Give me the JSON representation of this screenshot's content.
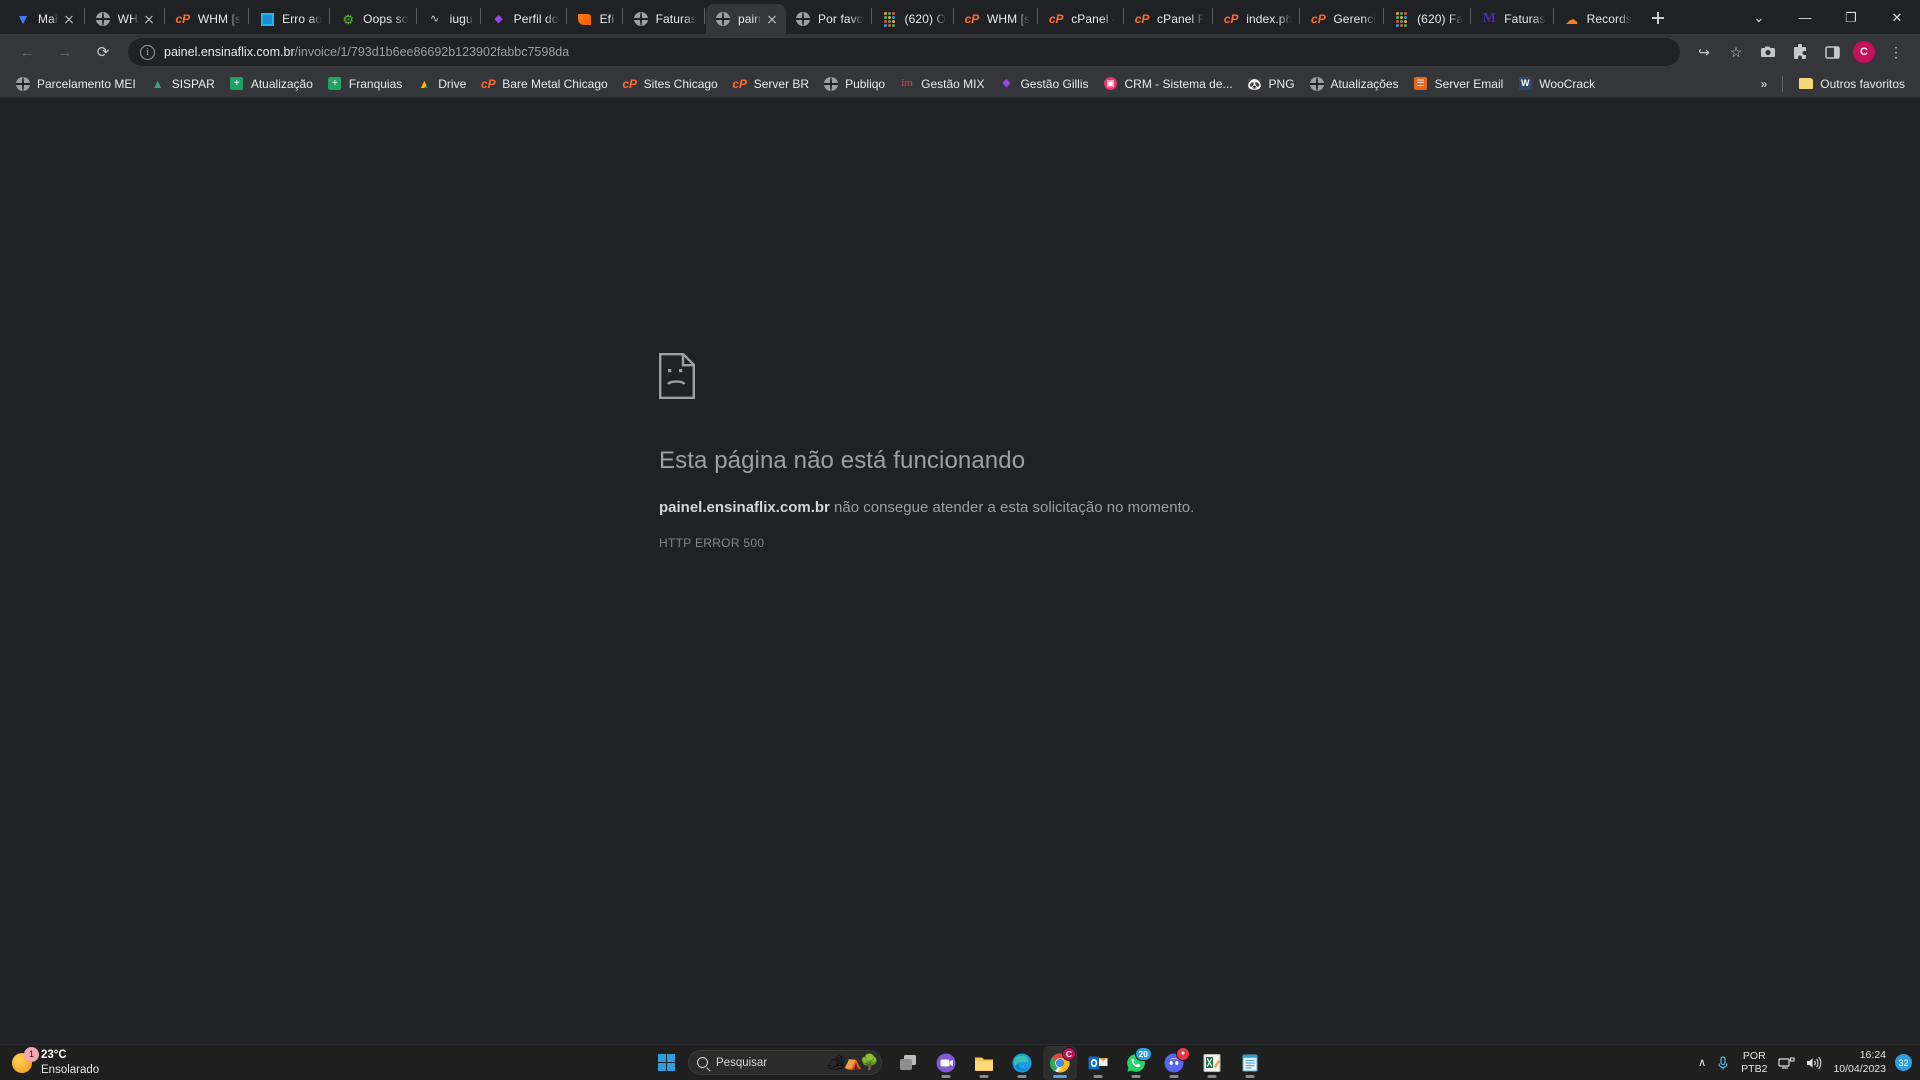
{
  "window": {
    "minimize_label": "—",
    "maximize_label": "❐",
    "close_label": "✕",
    "tablist_label": "⌄"
  },
  "tabs": [
    {
      "title": "Mai",
      "icon": "vultr-icon",
      "active": false,
      "closable": true,
      "sep_after": true
    },
    {
      "title": "WH",
      "icon": "globe-icon",
      "active": false,
      "closable": true,
      "sep_after": true
    },
    {
      "title": "WHM [s",
      "icon": "cpanel-icon",
      "active": false,
      "closable": false,
      "sep_after": true
    },
    {
      "title": "Erro ao",
      "icon": "window-icon",
      "active": false,
      "closable": false,
      "sep_after": true
    },
    {
      "title": "Oops so",
      "icon": "gear-icon",
      "active": false,
      "closable": false,
      "sep_after": true
    },
    {
      "title": "iugu",
      "icon": "iugu-icon",
      "active": false,
      "closable": false,
      "sep_after": true
    },
    {
      "title": "Perfil do",
      "icon": "perfil-icon",
      "active": false,
      "closable": false,
      "sep_after": true
    },
    {
      "title": "Efí",
      "icon": "efi-icon",
      "active": false,
      "closable": false,
      "sep_after": true
    },
    {
      "title": "Faturas",
      "icon": "globe-icon",
      "active": false,
      "closable": false,
      "sep_after": true
    },
    {
      "title": "pain",
      "icon": "globe-icon",
      "active": true,
      "closable": true,
      "sep_after": false
    },
    {
      "title": "Por favo",
      "icon": "globe-icon",
      "active": false,
      "closable": false,
      "sep_after": true
    },
    {
      "title": "(620) O",
      "icon": "dots-icon",
      "active": false,
      "closable": false,
      "sep_after": true
    },
    {
      "title": "WHM [s",
      "icon": "cpanel-icon",
      "active": false,
      "closable": false,
      "sep_after": true
    },
    {
      "title": "cPanel -",
      "icon": "cpanel-icon",
      "active": false,
      "closable": false,
      "sep_after": true
    },
    {
      "title": "cPanel F",
      "icon": "cpanel-icon",
      "active": false,
      "closable": false,
      "sep_after": true
    },
    {
      "title": "index.ph",
      "icon": "cpanel-icon",
      "active": false,
      "closable": false,
      "sep_after": true
    },
    {
      "title": "Gerenci",
      "icon": "cpanel-icon",
      "active": false,
      "closable": false,
      "sep_after": true
    },
    {
      "title": "(620) Fa",
      "icon": "dots-icon",
      "active": false,
      "closable": false,
      "sep_after": true
    },
    {
      "title": "Faturas",
      "icon": "m-icon",
      "active": false,
      "closable": false,
      "sep_after": true
    },
    {
      "title": "Records",
      "icon": "cloudflare-icon",
      "active": false,
      "closable": false,
      "sep_after": false
    }
  ],
  "newtab_label": "+",
  "toolbar": {
    "back_label": "←",
    "forward_label": "→",
    "reload_label": "⟳",
    "site_info_label": "i",
    "url_domain": "painel.ensinaflix.com.br",
    "url_path": "/invoice/1/793d1b6ee86692b123902fabbc7598da",
    "share_label": "↪",
    "bookmark_label": "☆",
    "screenshot_label": "▣",
    "extensions_label": "❖",
    "sidepanel_label": "▢",
    "profile_initial": "C",
    "menu_label": "⋮"
  },
  "bookmarks": {
    "items": [
      {
        "label": "Parcelamento MEI",
        "icon": "globe-icon"
      },
      {
        "label": "SISPAR",
        "icon": "sispar-icon"
      },
      {
        "label": "Atualização",
        "icon": "sheets-icon"
      },
      {
        "label": "Franquias",
        "icon": "sheets-icon"
      },
      {
        "label": "Drive",
        "icon": "drive-icon"
      },
      {
        "label": "Bare Metal Chicago",
        "icon": "cpanel-icon"
      },
      {
        "label": "Sites Chicago",
        "icon": "cpanel-icon"
      },
      {
        "label": "Server BR",
        "icon": "cpanel-icon"
      },
      {
        "label": "Publiqo",
        "icon": "globe-icon"
      },
      {
        "label": "Gestão MIX",
        "icon": "im-icon"
      },
      {
        "label": "Gestão Gillis",
        "icon": "perfil-icon"
      },
      {
        "label": "CRM - Sistema de...",
        "icon": "crm-icon"
      },
      {
        "label": "PNG",
        "icon": "panda-icon"
      },
      {
        "label": "Atualizações",
        "icon": "globe-icon"
      },
      {
        "label": "Server Email",
        "icon": "mail-icon"
      },
      {
        "label": "WooCrack",
        "icon": "woo-icon"
      }
    ],
    "overflow_label": "»",
    "other_label": "Outros favoritos",
    "other_icon": "folder-icon"
  },
  "error_page": {
    "icon": "sad-page-icon",
    "title": "Esta página não está funcionando",
    "domain": "painel.ensinaflix.com.br",
    "message": " não consegue atender a esta solicitação no momento.",
    "code": "HTTP ERROR 500"
  },
  "taskbar": {
    "weather": {
      "temperature": "23°C",
      "condition": "Ensolarado",
      "badge": "1",
      "icon": "sun-icon"
    },
    "start_label": "start-icon",
    "search_placeholder": "Pesquisar",
    "apps": [
      {
        "name": "task-view",
        "badge": "",
        "active": false
      },
      {
        "name": "teams",
        "badge": "",
        "active": false
      },
      {
        "name": "file-explorer",
        "badge": "",
        "active": false
      },
      {
        "name": "edge",
        "badge": "",
        "active": false
      },
      {
        "name": "chrome",
        "badge": "C",
        "active": true
      },
      {
        "name": "outlook",
        "badge": "",
        "active": false
      },
      {
        "name": "whatsapp",
        "badge": "20",
        "active": false
      },
      {
        "name": "discord",
        "badge": "●",
        "active": false
      },
      {
        "name": "excel",
        "badge": "",
        "active": false
      },
      {
        "name": "notepad",
        "badge": "",
        "active": false
      }
    ],
    "tray": {
      "chevron_label": "∧",
      "mic_label": "mic-icon",
      "lang_line1": "POR",
      "lang_line2": "PTB2",
      "network_label": "network-icon",
      "volume_label": "volume-icon",
      "time": "16:24",
      "date": "10/04/2023",
      "notification_count": "32"
    }
  }
}
